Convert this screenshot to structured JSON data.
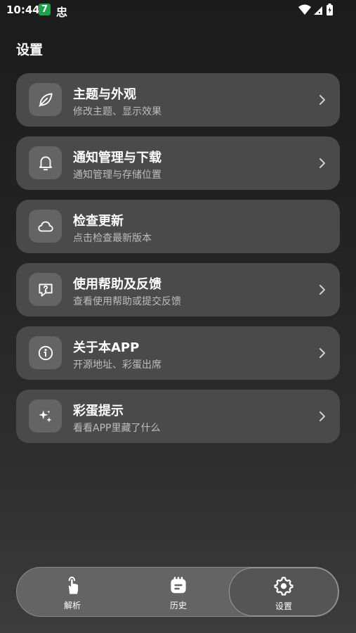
{
  "status_bar": {
    "time": "10:44",
    "badge": "7",
    "app_glyph": "忠",
    "icons": [
      "wifi-icon",
      "signal-icon",
      "battery-charging-icon"
    ]
  },
  "page": {
    "title": "设置"
  },
  "settings": [
    {
      "title": "主题与外观",
      "subtitle": "修改主题、显示效果",
      "icon": "leaf-icon",
      "has_chevron": true
    },
    {
      "title": "通知管理与下载",
      "subtitle": "通知管理与存储位置",
      "icon": "bell-icon",
      "has_chevron": true
    },
    {
      "title": "检查更新",
      "subtitle": "点击检查最新版本",
      "icon": "cloud-icon",
      "has_chevron": false
    },
    {
      "title": "使用帮助及反馈",
      "subtitle": "查看使用帮助或提交反馈",
      "icon": "help-chat-icon",
      "has_chevron": true
    },
    {
      "title": "关于本APP",
      "subtitle": "开源地址、彩蛋出席",
      "icon": "info-icon",
      "has_chevron": true
    },
    {
      "title": "彩蛋提示",
      "subtitle": "看看APP里藏了什么",
      "icon": "sparkle-icon",
      "has_chevron": true
    }
  ],
  "nav": [
    {
      "label": "解析",
      "icon": "tap-icon",
      "active": false
    },
    {
      "label": "历史",
      "icon": "history-icon",
      "active": false
    },
    {
      "label": "设置",
      "icon": "gear-icon",
      "active": true
    }
  ],
  "colors": {
    "card": "#4a4a4a",
    "icon_box": "#646464",
    "nav_bg": "#646464",
    "badge": "#1aa34a"
  }
}
